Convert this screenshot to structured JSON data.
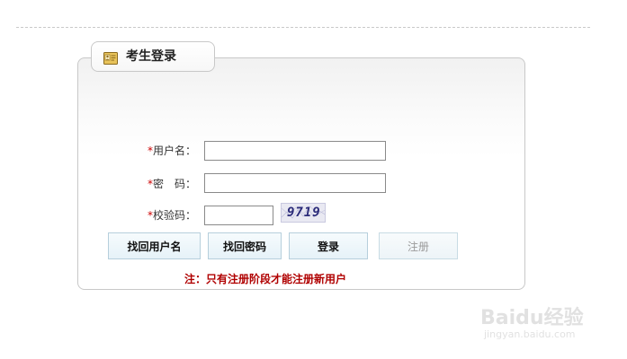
{
  "login_panel": {
    "title": "考生登录",
    "title_icon": "id-card-icon"
  },
  "form": {
    "username": {
      "required_mark": "*",
      "label": "用户名：",
      "value": ""
    },
    "password": {
      "required_mark": "*",
      "label": "密　码：",
      "value": ""
    },
    "captcha": {
      "required_mark": "*",
      "label": "校验码：",
      "value": "",
      "image_text": "9719"
    }
  },
  "buttons": {
    "find_username": "找回用户名",
    "find_password": "找回密码",
    "login": "登录",
    "register": "注册"
  },
  "notice": "注：只有注册阶段才能注册新用户",
  "watermark": {
    "logo": "Baidu经验",
    "site": "jingyan.baidu.com"
  },
  "colors": {
    "required": "#cc0000",
    "notice": "#b00000",
    "button_border": "#b6cfdc"
  }
}
